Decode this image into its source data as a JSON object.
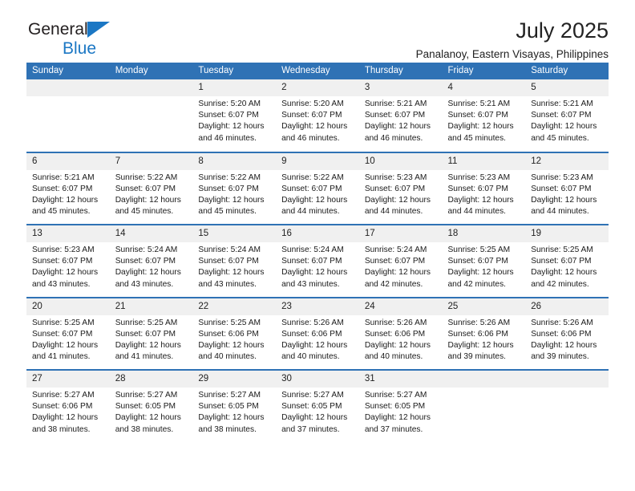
{
  "brand": {
    "line1": "General",
    "line2": "Blue",
    "accent_color": "#1b77c4"
  },
  "header": {
    "month_title": "July 2025",
    "location": "Panalanoy, Eastern Visayas, Philippines",
    "header_band_color": "#2f72b5",
    "daynum_band_color": "#f0f0f0"
  },
  "weekdays": [
    "Sunday",
    "Monday",
    "Tuesday",
    "Wednesday",
    "Thursday",
    "Friday",
    "Saturday"
  ],
  "labels": {
    "sunrise": "Sunrise:",
    "sunset": "Sunset:",
    "daylight": "Daylight:"
  },
  "weeks": [
    [
      {
        "day": "",
        "empty": true
      },
      {
        "day": "",
        "empty": true
      },
      {
        "day": "1",
        "sunrise": "Sunrise: 5:20 AM",
        "sunset": "Sunset: 6:07 PM",
        "daylight1": "Daylight: 12 hours",
        "daylight2": "and 46 minutes."
      },
      {
        "day": "2",
        "sunrise": "Sunrise: 5:20 AM",
        "sunset": "Sunset: 6:07 PM",
        "daylight1": "Daylight: 12 hours",
        "daylight2": "and 46 minutes."
      },
      {
        "day": "3",
        "sunrise": "Sunrise: 5:21 AM",
        "sunset": "Sunset: 6:07 PM",
        "daylight1": "Daylight: 12 hours",
        "daylight2": "and 46 minutes."
      },
      {
        "day": "4",
        "sunrise": "Sunrise: 5:21 AM",
        "sunset": "Sunset: 6:07 PM",
        "daylight1": "Daylight: 12 hours",
        "daylight2": "and 45 minutes."
      },
      {
        "day": "5",
        "sunrise": "Sunrise: 5:21 AM",
        "sunset": "Sunset: 6:07 PM",
        "daylight1": "Daylight: 12 hours",
        "daylight2": "and 45 minutes."
      }
    ],
    [
      {
        "day": "6",
        "sunrise": "Sunrise: 5:21 AM",
        "sunset": "Sunset: 6:07 PM",
        "daylight1": "Daylight: 12 hours",
        "daylight2": "and 45 minutes."
      },
      {
        "day": "7",
        "sunrise": "Sunrise: 5:22 AM",
        "sunset": "Sunset: 6:07 PM",
        "daylight1": "Daylight: 12 hours",
        "daylight2": "and 45 minutes."
      },
      {
        "day": "8",
        "sunrise": "Sunrise: 5:22 AM",
        "sunset": "Sunset: 6:07 PM",
        "daylight1": "Daylight: 12 hours",
        "daylight2": "and 45 minutes."
      },
      {
        "day": "9",
        "sunrise": "Sunrise: 5:22 AM",
        "sunset": "Sunset: 6:07 PM",
        "daylight1": "Daylight: 12 hours",
        "daylight2": "and 44 minutes."
      },
      {
        "day": "10",
        "sunrise": "Sunrise: 5:23 AM",
        "sunset": "Sunset: 6:07 PM",
        "daylight1": "Daylight: 12 hours",
        "daylight2": "and 44 minutes."
      },
      {
        "day": "11",
        "sunrise": "Sunrise: 5:23 AM",
        "sunset": "Sunset: 6:07 PM",
        "daylight1": "Daylight: 12 hours",
        "daylight2": "and 44 minutes."
      },
      {
        "day": "12",
        "sunrise": "Sunrise: 5:23 AM",
        "sunset": "Sunset: 6:07 PM",
        "daylight1": "Daylight: 12 hours",
        "daylight2": "and 44 minutes."
      }
    ],
    [
      {
        "day": "13",
        "sunrise": "Sunrise: 5:23 AM",
        "sunset": "Sunset: 6:07 PM",
        "daylight1": "Daylight: 12 hours",
        "daylight2": "and 43 minutes."
      },
      {
        "day": "14",
        "sunrise": "Sunrise: 5:24 AM",
        "sunset": "Sunset: 6:07 PM",
        "daylight1": "Daylight: 12 hours",
        "daylight2": "and 43 minutes."
      },
      {
        "day": "15",
        "sunrise": "Sunrise: 5:24 AM",
        "sunset": "Sunset: 6:07 PM",
        "daylight1": "Daylight: 12 hours",
        "daylight2": "and 43 minutes."
      },
      {
        "day": "16",
        "sunrise": "Sunrise: 5:24 AM",
        "sunset": "Sunset: 6:07 PM",
        "daylight1": "Daylight: 12 hours",
        "daylight2": "and 43 minutes."
      },
      {
        "day": "17",
        "sunrise": "Sunrise: 5:24 AM",
        "sunset": "Sunset: 6:07 PM",
        "daylight1": "Daylight: 12 hours",
        "daylight2": "and 42 minutes."
      },
      {
        "day": "18",
        "sunrise": "Sunrise: 5:25 AM",
        "sunset": "Sunset: 6:07 PM",
        "daylight1": "Daylight: 12 hours",
        "daylight2": "and 42 minutes."
      },
      {
        "day": "19",
        "sunrise": "Sunrise: 5:25 AM",
        "sunset": "Sunset: 6:07 PM",
        "daylight1": "Daylight: 12 hours",
        "daylight2": "and 42 minutes."
      }
    ],
    [
      {
        "day": "20",
        "sunrise": "Sunrise: 5:25 AM",
        "sunset": "Sunset: 6:07 PM",
        "daylight1": "Daylight: 12 hours",
        "daylight2": "and 41 minutes."
      },
      {
        "day": "21",
        "sunrise": "Sunrise: 5:25 AM",
        "sunset": "Sunset: 6:07 PM",
        "daylight1": "Daylight: 12 hours",
        "daylight2": "and 41 minutes."
      },
      {
        "day": "22",
        "sunrise": "Sunrise: 5:25 AM",
        "sunset": "Sunset: 6:06 PM",
        "daylight1": "Daylight: 12 hours",
        "daylight2": "and 40 minutes."
      },
      {
        "day": "23",
        "sunrise": "Sunrise: 5:26 AM",
        "sunset": "Sunset: 6:06 PM",
        "daylight1": "Daylight: 12 hours",
        "daylight2": "and 40 minutes."
      },
      {
        "day": "24",
        "sunrise": "Sunrise: 5:26 AM",
        "sunset": "Sunset: 6:06 PM",
        "daylight1": "Daylight: 12 hours",
        "daylight2": "and 40 minutes."
      },
      {
        "day": "25",
        "sunrise": "Sunrise: 5:26 AM",
        "sunset": "Sunset: 6:06 PM",
        "daylight1": "Daylight: 12 hours",
        "daylight2": "and 39 minutes."
      },
      {
        "day": "26",
        "sunrise": "Sunrise: 5:26 AM",
        "sunset": "Sunset: 6:06 PM",
        "daylight1": "Daylight: 12 hours",
        "daylight2": "and 39 minutes."
      }
    ],
    [
      {
        "day": "27",
        "sunrise": "Sunrise: 5:27 AM",
        "sunset": "Sunset: 6:06 PM",
        "daylight1": "Daylight: 12 hours",
        "daylight2": "and 38 minutes."
      },
      {
        "day": "28",
        "sunrise": "Sunrise: 5:27 AM",
        "sunset": "Sunset: 6:05 PM",
        "daylight1": "Daylight: 12 hours",
        "daylight2": "and 38 minutes."
      },
      {
        "day": "29",
        "sunrise": "Sunrise: 5:27 AM",
        "sunset": "Sunset: 6:05 PM",
        "daylight1": "Daylight: 12 hours",
        "daylight2": "and 38 minutes."
      },
      {
        "day": "30",
        "sunrise": "Sunrise: 5:27 AM",
        "sunset": "Sunset: 6:05 PM",
        "daylight1": "Daylight: 12 hours",
        "daylight2": "and 37 minutes."
      },
      {
        "day": "31",
        "sunrise": "Sunrise: 5:27 AM",
        "sunset": "Sunset: 6:05 PM",
        "daylight1": "Daylight: 12 hours",
        "daylight2": "and 37 minutes."
      },
      {
        "day": "",
        "empty": true
      },
      {
        "day": "",
        "empty": true
      }
    ]
  ]
}
